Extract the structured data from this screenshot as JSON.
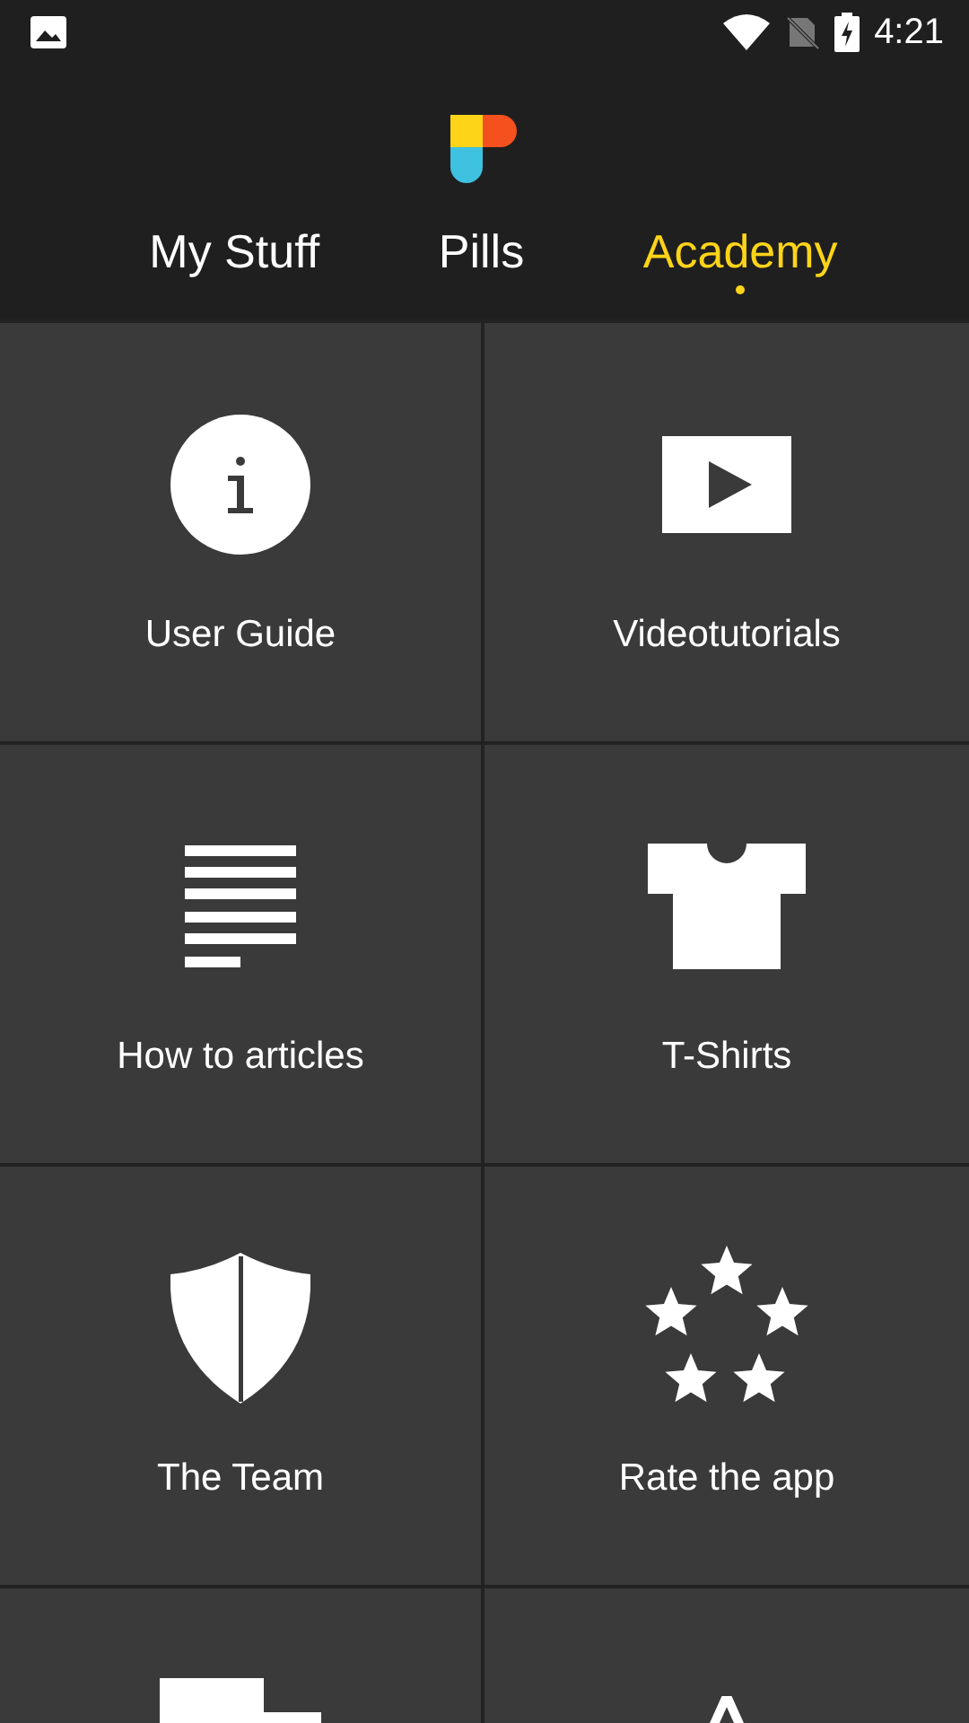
{
  "status_bar": {
    "time": "4:21"
  },
  "tabs": [
    {
      "label": "My Stuff",
      "selected": false
    },
    {
      "label": "Pills",
      "selected": false
    },
    {
      "label": "Academy",
      "selected": true
    }
  ],
  "tiles": [
    {
      "kind": "info",
      "label": "User Guide"
    },
    {
      "kind": "video",
      "label": "Videotutorials"
    },
    {
      "kind": "article",
      "label": "How to articles"
    },
    {
      "kind": "shirt",
      "label": "T-Shirts"
    },
    {
      "kind": "shield",
      "label": "The Team"
    },
    {
      "kind": "stars",
      "label": "Rate the app"
    },
    {
      "kind": "cards"
    },
    {
      "kind": "peak"
    }
  ]
}
